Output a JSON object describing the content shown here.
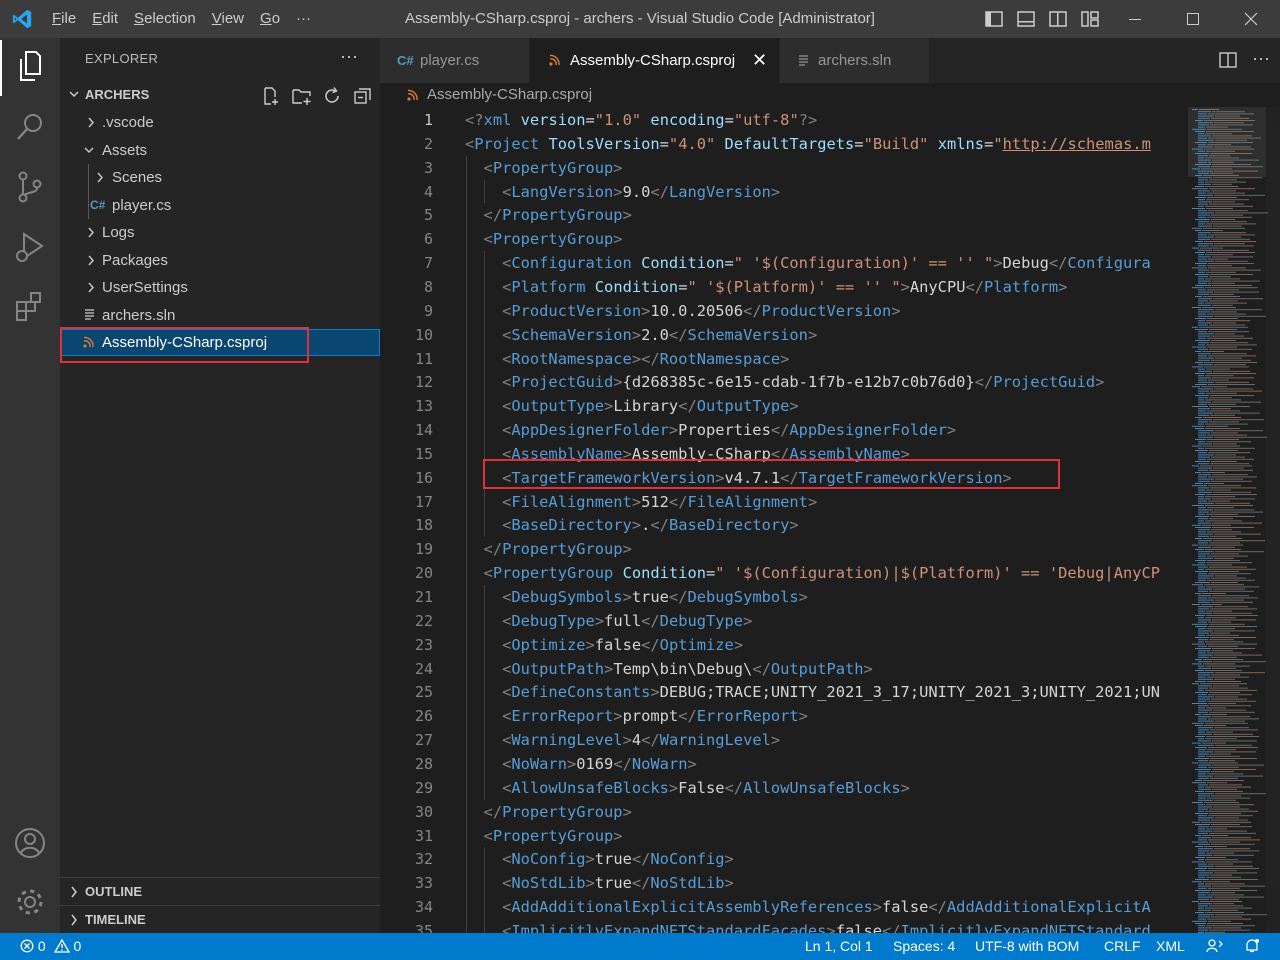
{
  "window": {
    "title": "Assembly-CSharp.csproj - archers - Visual Studio Code [Administrator]",
    "menu": [
      "File",
      "Edit",
      "Selection",
      "View",
      "Go",
      "···"
    ],
    "layout_icons": [
      "toggle-primary-sidebar-icon",
      "toggle-panel-icon",
      "toggle-secondary-sidebar-icon",
      "customize-layout-icon"
    ]
  },
  "activity_bar": {
    "items": [
      "explorer-icon",
      "search-icon",
      "source-control-icon",
      "run-debug-icon",
      "extensions-icon"
    ],
    "bottom": [
      "accounts-icon",
      "manage-gear-icon"
    ]
  },
  "sidebar": {
    "title": "EXPLORER",
    "more": "···",
    "workspace": "ARCHERS",
    "tree": [
      {
        "label": ".vscode",
        "type": "folder",
        "expanded": false,
        "depth": 0
      },
      {
        "label": "Assets",
        "type": "folder",
        "expanded": true,
        "depth": 0
      },
      {
        "label": "Scenes",
        "type": "folder",
        "expanded": false,
        "depth": 1
      },
      {
        "label": "player.cs",
        "type": "csharp",
        "depth": 1
      },
      {
        "label": "Logs",
        "type": "folder",
        "expanded": false,
        "depth": 0
      },
      {
        "label": "Packages",
        "type": "folder",
        "expanded": false,
        "depth": 0
      },
      {
        "label": "UserSettings",
        "type": "folder",
        "expanded": false,
        "depth": 0
      },
      {
        "label": "archers.sln",
        "type": "sln",
        "depth": 0
      },
      {
        "label": "Assembly-CSharp.csproj",
        "type": "rss",
        "depth": 0,
        "selected": true
      }
    ],
    "outline": "OUTLINE",
    "timeline": "TIMELINE"
  },
  "tabs": [
    {
      "label": "player.cs",
      "icon": "C#",
      "active": false
    },
    {
      "label": "Assembly-CSharp.csproj",
      "icon": "rss",
      "active": true,
      "close": "✕"
    },
    {
      "label": "archers.sln",
      "icon": "≡",
      "active": false
    }
  ],
  "breadcrumb": "Assembly-CSharp.csproj",
  "editor": {
    "lines": [
      "<?xml version=\"1.0\" encoding=\"utf-8\"?>",
      "<Project ToolsVersion=\"4.0\" DefaultTargets=\"Build\" xmlns=\"http://schemas.m",
      "  <PropertyGroup>",
      "    <LangVersion>9.0</LangVersion>",
      "  </PropertyGroup>",
      "  <PropertyGroup>",
      "    <Configuration Condition=\" '$(Configuration)' == '' \">Debug</Configura",
      "    <Platform Condition=\" '$(Platform)' == '' \">AnyCPU</Platform>",
      "    <ProductVersion>10.0.20506</ProductVersion>",
      "    <SchemaVersion>2.0</SchemaVersion>",
      "    <RootNamespace></RootNamespace>",
      "    <ProjectGuid>{d268385c-6e15-cdab-1f7b-e12b7c0b76d0}</ProjectGuid>",
      "    <OutputType>Library</OutputType>",
      "    <AppDesignerFolder>Properties</AppDesignerFolder>",
      "    <AssemblyName>Assembly-CSharp</AssemblyName>",
      "    <TargetFrameworkVersion>v4.7.1</TargetFrameworkVersion>",
      "    <FileAlignment>512</FileAlignment>",
      "    <BaseDirectory>.</BaseDirectory>",
      "  </PropertyGroup>",
      "  <PropertyGroup Condition=\" '$(Configuration)|$(Platform)' == 'Debug|AnyCP",
      "    <DebugSymbols>true</DebugSymbols>",
      "    <DebugType>full</DebugType>",
      "    <Optimize>false</Optimize>",
      "    <OutputPath>Temp\\bin\\Debug\\</OutputPath>",
      "    <DefineConstants>DEBUG;TRACE;UNITY_2021_3_17;UNITY_2021_3;UNITY_2021;UN",
      "    <ErrorReport>prompt</ErrorReport>",
      "    <WarningLevel>4</WarningLevel>",
      "    <NoWarn>0169</NoWarn>",
      "    <AllowUnsafeBlocks>False</AllowUnsafeBlocks>",
      "  </PropertyGroup>",
      "  <PropertyGroup>",
      "    <NoConfig>true</NoConfig>",
      "    <NoStdLib>true</NoStdLib>",
      "    <AddAdditionalExplicitAssemblyReferences>false</AddAdditionalExplicitA",
      "    <ImplicitlyExpandNETStandardFacades>false</ImplicitlyExpandNETStandard"
    ],
    "current_line": 1,
    "highlighted_line": 16
  },
  "status_bar": {
    "errors": "0",
    "warnings": "0",
    "position": "Ln 1, Col 1",
    "spaces": "Spaces: 4",
    "encoding": "UTF-8 with BOM",
    "eol": "CRLF",
    "language": "XML"
  },
  "colors": {
    "accent": "#007acc",
    "highlight_box": "#e0303a",
    "selection": "#094771",
    "tag": "#569cd6",
    "attribute": "#9cdcfe",
    "string": "#ce9178"
  }
}
